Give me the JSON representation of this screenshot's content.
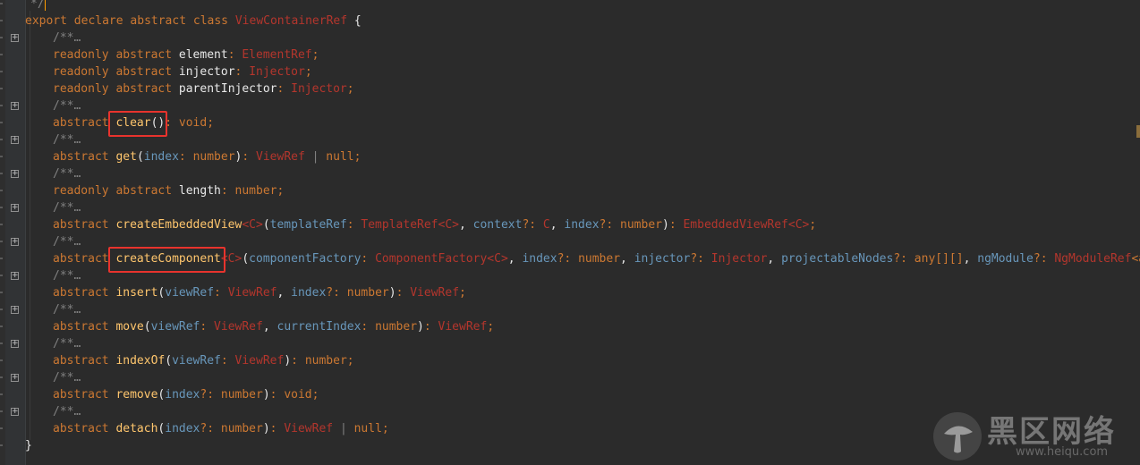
{
  "editor": {
    "comment_close": "*/",
    "fold_placeholder": "/**…",
    "line1": {
      "export": "export",
      "declare": "declare",
      "abstract": "abstract",
      "class": "class",
      "name": "ViewContainerRef",
      "brace": "{"
    },
    "element_line": {
      "readonly": "readonly",
      "abstract": "abstract",
      "name": "element",
      "colon": ":",
      "type": "ElementRef",
      "semi": ";"
    },
    "injector_line": {
      "readonly": "readonly",
      "abstract": "abstract",
      "name": "injector",
      "colon": ":",
      "type": "Injector",
      "semi": ";"
    },
    "parent_line": {
      "readonly": "readonly",
      "abstract": "abstract",
      "name": "parentInjector",
      "colon": ":",
      "type": "Injector",
      "semi": ";"
    },
    "clear_line": {
      "abstract": "abstract",
      "name": "clear",
      "parens": "()",
      "colon": ":",
      "ret": "void",
      "semi": ";"
    },
    "get_line": {
      "abstract": "abstract",
      "name": "get",
      "open": "(",
      "p1": "index",
      "colon1": ":",
      "t1": "number",
      "close": ")",
      "colon2": ":",
      "ret": "ViewRef",
      "bar": "|",
      "ret2": "null",
      "semi": ";"
    },
    "length_line": {
      "readonly": "readonly",
      "abstract": "abstract",
      "name": "length",
      "colon": ":",
      "type": "number",
      "semi": ";"
    },
    "embedded_line": {
      "abstract": "abstract",
      "name": "createEmbeddedView",
      "generic": "<C>",
      "open": "(",
      "p1": "templateRef",
      "colon1": ":",
      "t1": "TemplateRef",
      "t1g": "<C>",
      "comma1": ",",
      "p2": "context",
      "q2": "?:",
      "t2": "C",
      "comma2": ",",
      "p3": "index",
      "q3": "?:",
      "t3": "number",
      "close": ")",
      "colon": ":",
      "ret": "EmbeddedViewRef",
      "retg": "<C>",
      "semi": ";"
    },
    "component_line": {
      "abstract": "abstract",
      "name": "createComponent",
      "generic": "<C>",
      "open": "(",
      "p1": "componentFactory",
      "colon1": ":",
      "t1": "ComponentFactory",
      "t1g": "<C>",
      "comma1": ",",
      "p2": "index",
      "q2": "?:",
      "t2": "number",
      "comma2": ",",
      "p3": "injector",
      "q3": "?:",
      "t3": "Injector",
      "comma3": ",",
      "p4": "projectableNodes",
      "q4": "?:",
      "t4": "any[][]",
      "comma4": ",",
      "p5": "ngModule",
      "q5": "?:",
      "t5": "NgModuleRef",
      "t5g": "<any"
    },
    "insert_line": {
      "abstract": "abstract",
      "name": "insert",
      "open": "(",
      "p1": "viewRef",
      "colon1": ":",
      "t1": "ViewRef",
      "comma1": ",",
      "p2": "index",
      "q2": "?:",
      "t2": "number",
      "close": ")",
      "colon": ":",
      "ret": "ViewRef",
      "semi": ";"
    },
    "move_line": {
      "abstract": "abstract",
      "name": "move",
      "open": "(",
      "p1": "viewRef",
      "colon1": ":",
      "t1": "ViewRef",
      "comma1": ",",
      "p2": "currentIndex",
      "colon2": ":",
      "t2": "number",
      "close": ")",
      "colon": ":",
      "ret": "ViewRef",
      "semi": ";"
    },
    "indexof_line": {
      "abstract": "abstract",
      "name": "indexOf",
      "open": "(",
      "p1": "viewRef",
      "colon1": ":",
      "t1": "ViewRef",
      "close": ")",
      "colon": ":",
      "ret": "number",
      "semi": ";"
    },
    "remove_line": {
      "abstract": "abstract",
      "name": "remove",
      "open": "(",
      "p1": "index",
      "q1": "?:",
      "t1": "number",
      "close": ")",
      "colon": ":",
      "ret": "void",
      "semi": ";"
    },
    "detach_line": {
      "abstract": "abstract",
      "name": "detach",
      "open": "(",
      "p1": "index",
      "q1": "?:",
      "t1": "number",
      "close": ")",
      "colon": ":",
      "ret": "ViewRef",
      "bar": "|",
      "ret2": "null",
      "semi": ";"
    },
    "closing_brace": "}"
  },
  "watermark": {
    "title": "黑区网络",
    "subtitle": "www.heiqu.com"
  },
  "colors": {
    "background": "#2b2b2b",
    "keyword": "#cc7832",
    "type": "#b4362d",
    "function": "#ffc66d",
    "param": "#6897bb",
    "highlight": "#e8332d"
  }
}
